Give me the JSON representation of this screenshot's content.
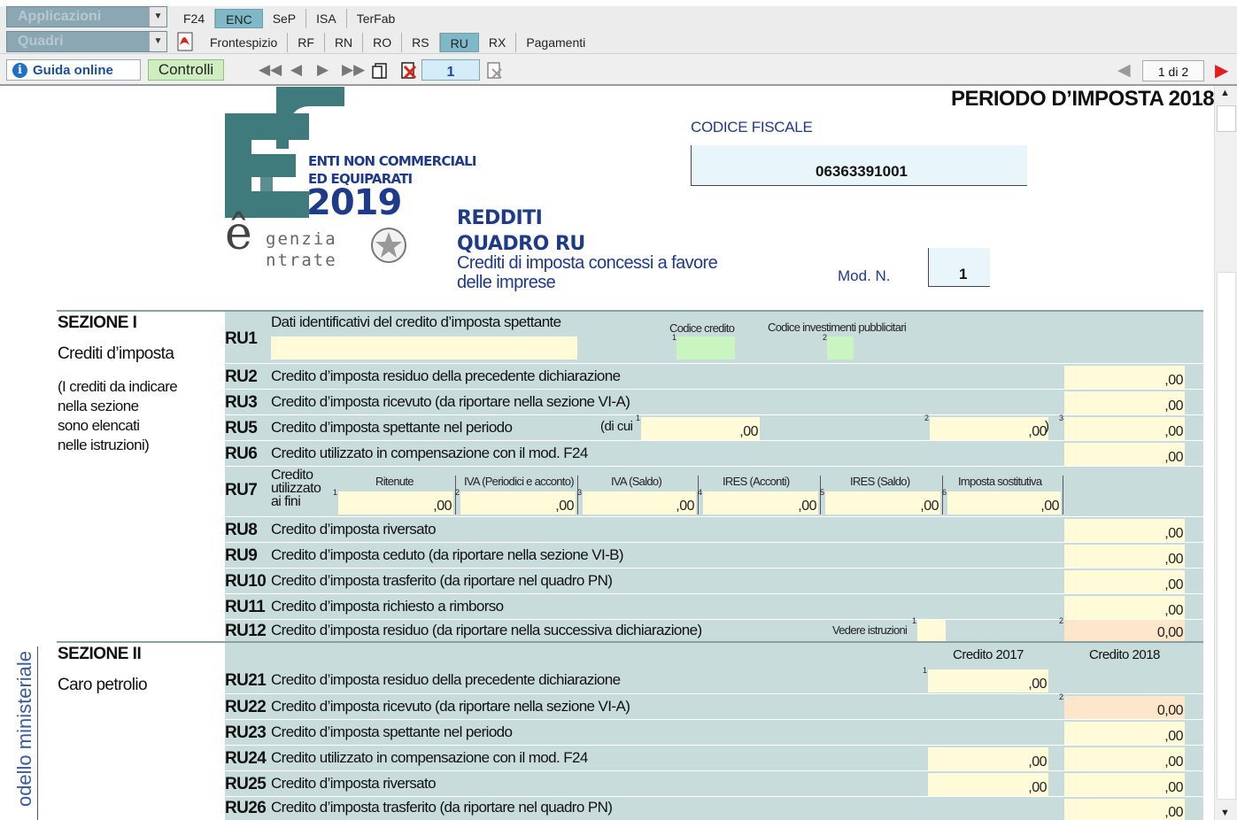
{
  "toolbar": {
    "combo1": "Applicazioni",
    "combo2": "Quadri",
    "row1_tabs": [
      "F24",
      "ENC",
      "SeP",
      "ISA",
      "TerFab"
    ],
    "row2_tabs": [
      "Frontespizio",
      "RF",
      "RN",
      "RO",
      "RS",
      "RU",
      "RX",
      "Pagamenti"
    ],
    "guida": "Guida online",
    "controlli": "Controlli",
    "page_field": "1",
    "page_counter": "1 di 2"
  },
  "header": {
    "periodo": "PERIODO D’IMPOSTA 2018",
    "enc_line1": "ENTI NON COMMERCIALI",
    "enc_line2": "ED EQUIPARATI",
    "enc_year": "2019",
    "agenzia_1": "genzia",
    "agenzia_2": "ntrate",
    "redditi": "REDDITI",
    "quadro": "QUADRO RU",
    "sub1": "Crediti di imposta concessi a favore",
    "sub2": "delle imprese",
    "cf_label": "CODICE FISCALE",
    "cf_value": "06363391001",
    "modn_label": "Mod. N.",
    "modn_value": "1"
  },
  "sezione1": {
    "title": "SEZIONE I",
    "subtitle": "Crediti d’imposta",
    "note1": "(I crediti da indicare",
    "note2": "nella sezione",
    "note3": "sono elencati",
    "note4": "nelle istruzioni)"
  },
  "sezione2": {
    "title": "SEZIONE II",
    "subtitle": "Caro petrolio",
    "col1": "Credito 2017",
    "col2": "Credito 2018"
  },
  "sidebar_text": "odello ministeriale",
  "ru1": {
    "code": "RU1",
    "desc": "Dati identificativi del credito d’imposta spettante",
    "col1": "Codice credito",
    "col2": "Codice investimenti pubblicitari"
  },
  "rows1": [
    {
      "code": "RU2",
      "desc": "Credito d’imposta residuo della precedente dichiarazione",
      "value": ",00"
    },
    {
      "code": "RU3",
      "desc": "Credito d’imposta ricevuto (da riportare nella sezione VI-A)",
      "value": ",00"
    },
    {
      "code": "RU5",
      "desc": "Credito d’imposta spettante nel periodo",
      "value": ",00"
    },
    {
      "code": "RU6",
      "desc": "Credito utilizzato in compensazione con il mod. F24",
      "value": ",00"
    }
  ],
  "ru5_extra": {
    "dicui": "(di cui",
    "v1": ",00",
    "v2": ",00",
    "close": ")"
  },
  "ru7": {
    "code": "RU7",
    "label1": "Credito",
    "label2": "utilizzato",
    "label3": "ai fini",
    "cols": [
      "Ritenute",
      "IVA (Periodici e acconto)",
      "IVA (Saldo)",
      "IRES (Acconti)",
      "IRES (Saldo)",
      "Imposta sostitutiva"
    ],
    "values": [
      ",00",
      ",00",
      ",00",
      ",00",
      ",00",
      ",00"
    ]
  },
  "rows2": [
    {
      "code": "RU8",
      "desc": "Credito d’imposta riversato",
      "value": ",00"
    },
    {
      "code": "RU9",
      "desc": "Credito d’imposta ceduto (da riportare nella sezione VI-B)",
      "value": ",00"
    },
    {
      "code": "RU10",
      "desc": "Credito d’imposta trasferito (da riportare nel quadro PN)",
      "value": ",00"
    },
    {
      "code": "RU11",
      "desc": "Credito d’imposta richiesto a rimborso",
      "value": ",00"
    },
    {
      "code": "RU12",
      "desc": "Credito d’imposta residuo (da riportare nella successiva dichiarazione)",
      "value": "0,00"
    }
  ],
  "ru12_note": "Vedere istruzioni",
  "rows3": [
    {
      "code": "RU21",
      "desc": "Credito d’imposta residuo della precedente dichiarazione",
      "v2017": ",00",
      "v2018": ""
    },
    {
      "code": "RU22",
      "desc": "Credito d’imposta ricevuto (da riportare nella sezione VI-A)",
      "v2017": "",
      "v2018": "0,00"
    },
    {
      "code": "RU23",
      "desc": "Credito d’imposta spettante nel periodo",
      "v2017": "",
      "v2018": ",00"
    },
    {
      "code": "RU24",
      "desc": "Credito utilizzato in compensazione con il mod. F24",
      "v2017": ",00",
      "v2018": ",00"
    },
    {
      "code": "RU25",
      "desc": "Credito d’imposta riversato",
      "v2017": ",00",
      "v2018": ",00"
    },
    {
      "code": "RU26",
      "desc": "Credito d’imposta trasferito (da riportare nel quadro PN)",
      "v2017": "",
      "v2018": ",00"
    }
  ],
  "colors": {
    "accent_blue": "#1e3a8a",
    "panel": "#c9dcdc",
    "field": "#fffbd9",
    "field_calc": "#fde6c9",
    "field_code": "#c8f5c0",
    "tab_active": "#7fb8c6"
  }
}
